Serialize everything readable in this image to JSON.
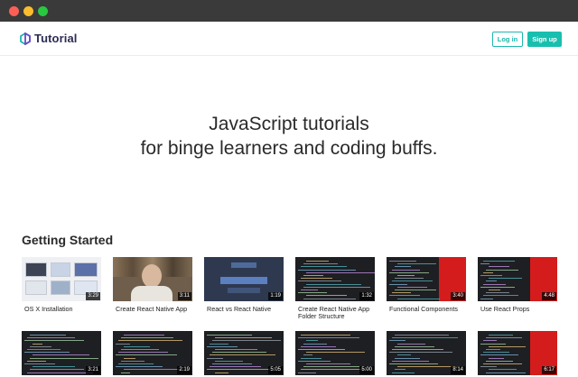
{
  "nav": {
    "logo_text": "Tutorial",
    "login_label": "Log in",
    "signup_label": "Sign up"
  },
  "hero": {
    "line1": "JavaScript tutorials",
    "line2": "for binge learners and coding buffs."
  },
  "section": {
    "title": "Getting Started"
  },
  "videos": [
    {
      "title": "OS X Installation",
      "duration": "3:29",
      "thumb": "light"
    },
    {
      "title": "Create React Native App",
      "duration": "3:11",
      "thumb": "photo"
    },
    {
      "title": "React vs React Native",
      "duration": "1:19",
      "thumb": "slide"
    },
    {
      "title": "Create React Native App Folder Structure",
      "duration": "1:32",
      "thumb": "code"
    },
    {
      "title": "Functional Components",
      "duration": "3:40",
      "thumb": "code-red"
    },
    {
      "title": "Use React Props",
      "duration": "4:48",
      "thumb": "code-red"
    },
    {
      "title": "",
      "duration": "3:21",
      "thumb": "code"
    },
    {
      "title": "",
      "duration": "2:19",
      "thumb": "code"
    },
    {
      "title": "",
      "duration": "5:05",
      "thumb": "code"
    },
    {
      "title": "",
      "duration": "5:00",
      "thumb": "code"
    },
    {
      "title": "",
      "duration": "8:14",
      "thumb": "code"
    },
    {
      "title": "",
      "duration": "6:17",
      "thumb": "code-red"
    }
  ]
}
